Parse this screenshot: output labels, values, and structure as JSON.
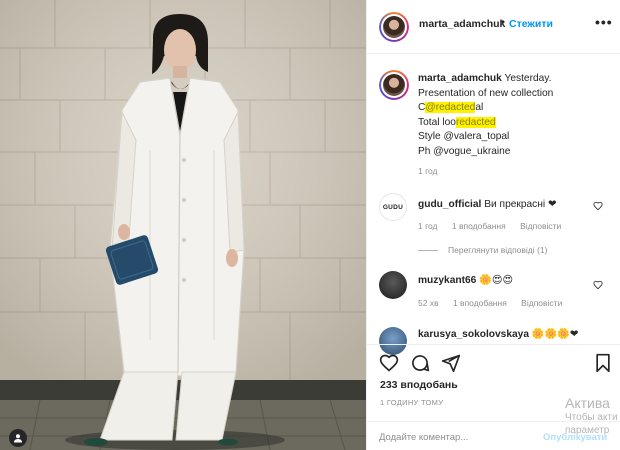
{
  "post": {
    "username": "marta_adamchuk",
    "follow_label": "Стежити",
    "dot": "•",
    "more": "•••"
  },
  "caption": {
    "username": "marta_adamchuk",
    "line1": "Yesterday.",
    "line2": "Presentation of new collection",
    "line3": "C",
    "line3_hidden": "@redacted",
    "line3_tail": "al",
    "line4": "Total loo",
    "line4_hidden": "redacted",
    "line5": "Style @valera_topal",
    "line6": "Ph @vogue_ukraine",
    "time": "1 год"
  },
  "comments": [
    {
      "avatar_text": "GUDU",
      "username": "gudu_official",
      "text": "Ви прекрасні ❤",
      "time": "1 год",
      "likes": "1 вподобання",
      "reply": "Відповісти",
      "view_replies": "Переглянути відповіді (1)"
    },
    {
      "username": "muzykant66",
      "text": "🌼😍😍",
      "time": "52 хв",
      "likes": "1 вподобання",
      "reply": "Відповісти"
    },
    {
      "username": "karusya_sokolovskaya",
      "text": "🌼🌼🌼❤"
    }
  ],
  "actions": {
    "likes_count": "233 вподобань",
    "post_time": "1 ГОДИНУ ТОМУ",
    "comment_placeholder": "Додайте коментар...",
    "publish_label": "Опублікувати"
  },
  "watermark": {
    "title": "Актива",
    "line1": "Чтобы акти",
    "line2": "параметр"
  },
  "icons": [
    "heart-icon",
    "comment-icon",
    "share-icon",
    "bookmark-icon",
    "more-icon",
    "user-tag-icon"
  ],
  "colors": {
    "accent": "#0095f6",
    "text": "#262626",
    "muted": "#8e8e8e",
    "heart": "#ed4956",
    "highlight": "#fff200"
  }
}
